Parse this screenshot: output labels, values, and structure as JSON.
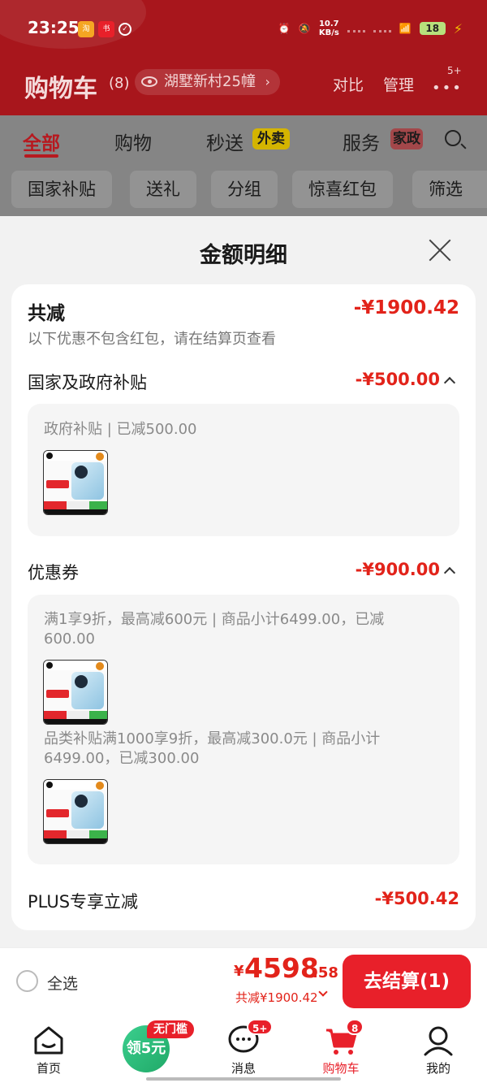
{
  "status_bar": {
    "time": "23:25",
    "net_speed_value": "10.7",
    "net_speed_unit": "KB/s",
    "battery": "18"
  },
  "header": {
    "title": "购物车",
    "count": "(8)",
    "address": "湖墅新村25幢",
    "compare": "对比",
    "manage": "管理",
    "more_badge": "5+"
  },
  "tabs": [
    {
      "label": "全部"
    },
    {
      "label": "购物"
    },
    {
      "label": "秒送",
      "tag": "外卖"
    },
    {
      "label": "服务",
      "tag": "家政"
    }
  ],
  "chips": [
    "国家补贴",
    "送礼",
    "分组",
    "惊喜红包",
    "筛选"
  ],
  "sheet": {
    "title": "金额明细",
    "total_label": "共减",
    "total_amount": "-¥1900.42",
    "note": "以下优惠不包含红包，请在结算页查看",
    "sections": {
      "gov": {
        "label": "国家及政府补贴",
        "amount": "-¥500.00",
        "detail": "政府补贴 | 已减500.00"
      },
      "coupon": {
        "label": "优惠券",
        "amount": "-¥900.00",
        "detail1": "满1享9折，最高减600元 | 商品小计6499.00，已减600.00",
        "detail2": "品类补贴满1000享9折，最高减300.0元 | 商品小计6499.00，已减300.00"
      },
      "plus": {
        "label": "PLUS专享立减",
        "amount": "-¥500.42"
      }
    }
  },
  "checkout": {
    "select_all": "全选",
    "currency": "¥",
    "total_int": "4598",
    "total_dec": ".58",
    "total_save": "共减¥1900.42",
    "button": "去结算(1)"
  },
  "tabbar": {
    "home": "首页",
    "coupon_label": "领5元",
    "coupon_tag": "无门槛",
    "messages": "消息",
    "messages_badge": "5+",
    "cart": "购物车",
    "cart_badge": "8",
    "mine": "我的"
  },
  "colors": {
    "brand_red": "#e8202a",
    "header_red": "#a8161c",
    "coupon_green": "#20a968"
  }
}
